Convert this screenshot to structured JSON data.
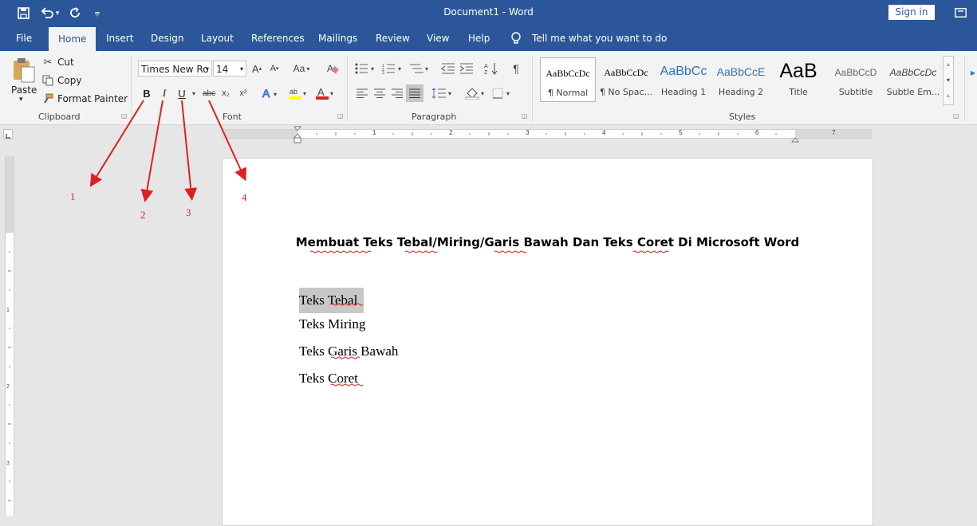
{
  "titlebar": {
    "document_title": "Document1 - Word",
    "sign_in": "Sign in"
  },
  "tabs": [
    {
      "label": "File"
    },
    {
      "label": "Home"
    },
    {
      "label": "Insert"
    },
    {
      "label": "Design"
    },
    {
      "label": "Layout"
    },
    {
      "label": "References"
    },
    {
      "label": "Mailings"
    },
    {
      "label": "Review"
    },
    {
      "label": "View"
    },
    {
      "label": "Help"
    }
  ],
  "tell_me": "Tell me what you want to do",
  "clipboard": {
    "paste": "Paste",
    "cut": "Cut",
    "copy": "Copy",
    "format_painter": "Format Painter",
    "group_label": "Clipboard"
  },
  "font": {
    "family": "Times New Ro",
    "size": "14",
    "bold": "B",
    "italic": "I",
    "underline": "U",
    "strikethrough": "abc",
    "subscript": "x₂",
    "superscript": "x²",
    "case": "Aa",
    "group_label": "Font"
  },
  "paragraph": {
    "pilcrow": "¶",
    "group_label": "Paragraph"
  },
  "styles": {
    "items": [
      {
        "sample": "AaBbCcDc",
        "name": "¶ Normal"
      },
      {
        "sample": "AaBbCcDc",
        "name": "¶ No Spac..."
      },
      {
        "sample": "AaBbCc",
        "name": "Heading 1"
      },
      {
        "sample": "AaBbCcE",
        "name": "Heading 2"
      },
      {
        "sample": "AaB",
        "name": "Title"
      },
      {
        "sample": "AaBbCcD",
        "name": "Subtitle"
      },
      {
        "sample": "AaBbCcDc",
        "name": "Subtle Em..."
      }
    ],
    "group_label": "Styles"
  },
  "ruler": {
    "numbers": [
      "1",
      "2",
      "3",
      "4",
      "5",
      "6",
      "7"
    ],
    "vnumbers": [
      "1",
      "2",
      "3"
    ]
  },
  "document": {
    "heading": "Membuat Teks Tebal/Miring/Garis Bawah Dan Teks Coret Di Microsoft Word",
    "lines": [
      "Teks Tebal",
      "Teks Miring",
      "Teks Garis Bawah",
      "Teks Coret"
    ]
  },
  "annotations": [
    "1",
    "2",
    "3",
    "4"
  ],
  "colors": {
    "title_bar": "#2b579a",
    "ribbon": "#f3f3f3",
    "annotation_red": "#e02020",
    "selection": "#c8c8c8"
  }
}
